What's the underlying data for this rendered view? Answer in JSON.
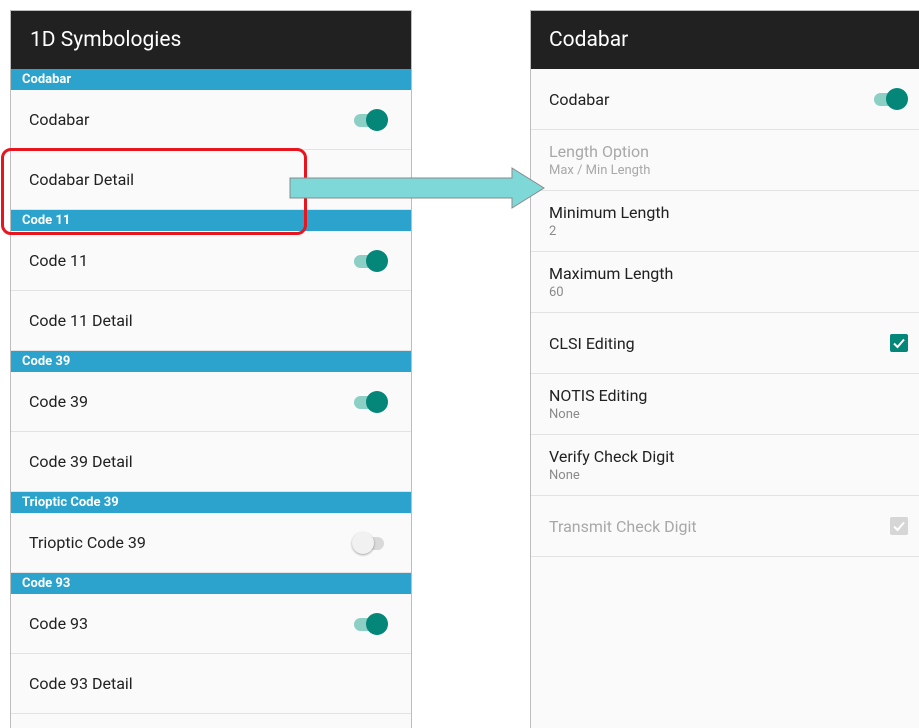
{
  "left": {
    "title": "1D Symbologies",
    "sections": [
      {
        "header": "Codabar",
        "rows": [
          {
            "label": "Codabar",
            "toggle": "on"
          },
          {
            "label": "Codabar Detail"
          }
        ]
      },
      {
        "header": "Code 11",
        "rows": [
          {
            "label": "Code 11",
            "toggle": "on"
          },
          {
            "label": "Code 11 Detail"
          }
        ]
      },
      {
        "header": "Code 39",
        "rows": [
          {
            "label": "Code 39",
            "toggle": "on"
          },
          {
            "label": "Code 39 Detail"
          }
        ]
      },
      {
        "header": "Trioptic Code 39",
        "rows": [
          {
            "label": "Trioptic Code 39",
            "toggle": "off"
          }
        ]
      },
      {
        "header": "Code 93",
        "rows": [
          {
            "label": "Code 93",
            "toggle": "on"
          },
          {
            "label": "Code 93 Detail"
          }
        ]
      }
    ]
  },
  "right": {
    "title": "Codabar",
    "rows": [
      {
        "title": "Codabar",
        "summary": "",
        "control": "toggle-on"
      },
      {
        "title": "Length Option",
        "summary": "Max / Min Length",
        "disabled": true
      },
      {
        "title": "Minimum Length",
        "summary": "2"
      },
      {
        "title": "Maximum Length",
        "summary": "60"
      },
      {
        "title": "CLSI Editing",
        "summary": "",
        "control": "checkbox-checked"
      },
      {
        "title": "NOTIS Editing",
        "summary": "None"
      },
      {
        "title": "Verify Check Digit",
        "summary": "None"
      },
      {
        "title": "Transmit Check Digit",
        "summary": "",
        "control": "checkbox-checked-disabled",
        "disabled": true
      }
    ]
  },
  "colors": {
    "appbar": "#212121",
    "section_header": "#2ba3cd",
    "accent_teal": "#048679",
    "highlight_red": "#e8141e",
    "arrow_fill": "#7fd8d8"
  },
  "icons": {
    "arrow": "right-arrow-icon",
    "check": "check-icon"
  }
}
